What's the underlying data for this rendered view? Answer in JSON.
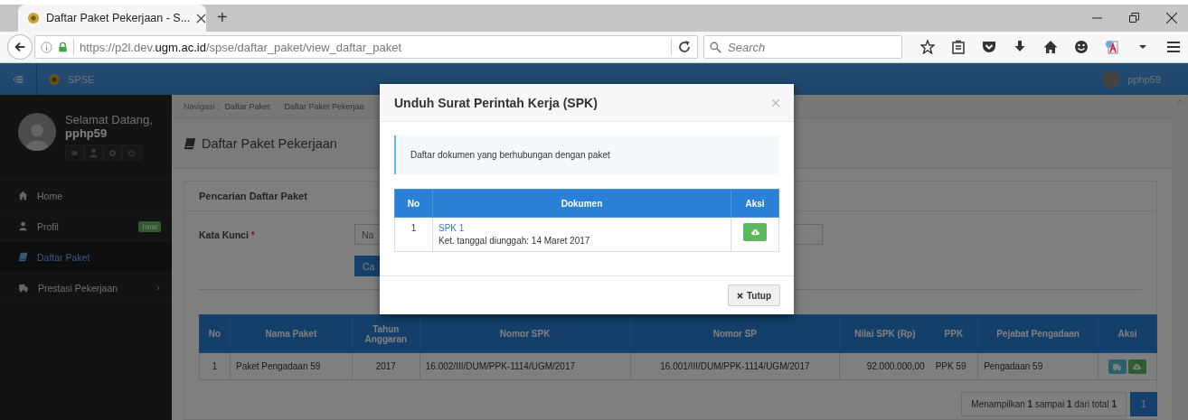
{
  "browser": {
    "tab": {
      "title": "Daftar Paket Pekerjaan - S...",
      "selected": true
    },
    "new_tab": "+",
    "url": {
      "prefix": "https://p2l.dev.",
      "domain": "ugm.ac.id",
      "path": "/spse/daftar_paket/view_daftar_paket"
    },
    "search": {
      "placeholder": "Search"
    }
  },
  "navbar": {
    "brand": "SPSE",
    "user": "pphp59"
  },
  "sidebar": {
    "greeting": "Selamat Datang,",
    "username": "pphp59",
    "items": [
      {
        "label": "Home",
        "selected": false,
        "has_submenu": false
      },
      {
        "label": "Profil",
        "badge": "new",
        "selected": false,
        "has_submenu": false
      },
      {
        "label": "Daftar Paket",
        "selected": true,
        "has_submenu": false
      },
      {
        "label": "Prestasi Pekerjaan",
        "selected": false,
        "has_submenu": true
      }
    ]
  },
  "breadcrumb": {
    "label": "Navigasi :",
    "items": [
      "Daftar Paket",
      "Daftar Paket Pekerjaa"
    ]
  },
  "page_title": "Daftar Paket Pekerjaan",
  "search_panel": {
    "title": "Pencarian Daftar Paket",
    "label": "Kata Kunci",
    "required_mark": "*",
    "placeholder": "Na",
    "button": "Ca"
  },
  "table": {
    "columns": [
      "No",
      "Nama Paket",
      "Tahun Anggaran",
      "Nomor SPK",
      "Nomor SP",
      "Nilai SPK (Rp)",
      "PPK",
      "Pejabat Pengadaan",
      "Aksi"
    ],
    "rows": [
      {
        "cells": [
          "1",
          "Paket Pengadaan 59",
          "2017",
          "16.002/III/DUM/PPK-1114/UGM/2017",
          "16.001/III/DUM/PPK-1114/UGM/2017",
          "92.000.000,00",
          "PPK 59",
          "Pengadaan 59"
        ]
      }
    ]
  },
  "pagination": {
    "summary": "Menampilkan **1** sampai **1** dari total **1**",
    "pages": [
      {
        "label": "1",
        "selected": true
      }
    ]
  },
  "modal": {
    "title": "Unduh Surat Perintah Kerja (SPK)",
    "info": "Daftar dokumen yang berhubungan dengan paket",
    "table": {
      "columns": [
        "No",
        "Dokumen",
        "Aksi"
      ],
      "rows": [
        {
          "no": "1",
          "document": "SPK 1",
          "note": "Ket. tanggal diunggah: 14 Maret 2017"
        }
      ]
    },
    "close_button": "Tutup"
  }
}
